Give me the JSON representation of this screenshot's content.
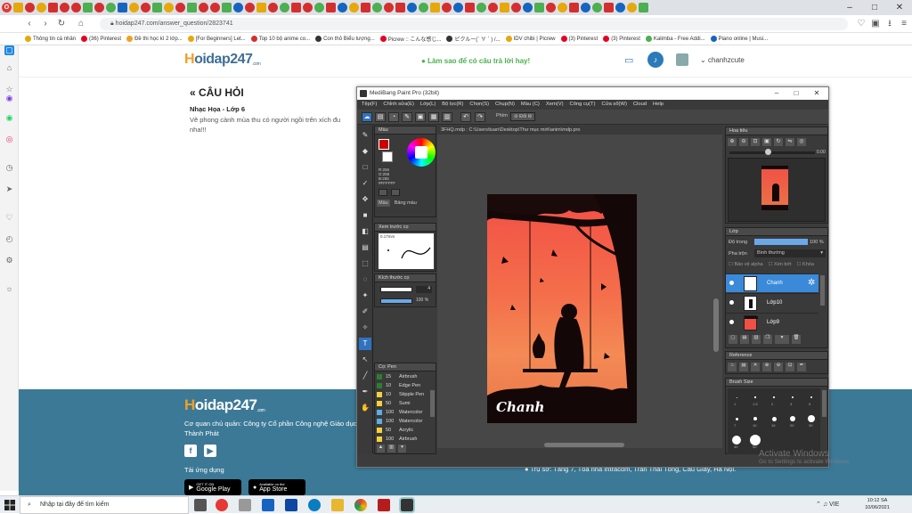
{
  "browser": {
    "url": "hoidap247.com/answer_question/2823741",
    "bookmarks": [
      "Thông tin cá nhân",
      "(36) Pinterest",
      "Đề thi học kì 2 lớp...",
      "[For Beginners] Let...",
      "Top 10 bộ anime co...",
      "Con thỏ Biểu tượng...",
      "Picrew :: こんな感じ...",
      "ピクルー(´ ∀ ` ) /...",
      "IDV chibi | Picrew",
      "(3) Pinterest",
      "(3) Pinterest",
      "Kalimba - Free Addi...",
      "Piano online | Musi..."
    ]
  },
  "site": {
    "logo_main": "oidap247",
    "logo_h": "H",
    "logo_sub": ".com",
    "help": "Làm sao để có câu trả lời hay!",
    "username": "chanhzcute"
  },
  "question": {
    "heading": "« CÂU HỎI",
    "meta": "Nhạc Họa - Lớp 6",
    "text": "Vẽ phong cảnh mùa thu có người ngồi trên xích đu nha!!!"
  },
  "footer": {
    "company": "Cơ quan chủ quản: Công ty Cổ phần Công nghệ Giáo dục Thành Phát",
    "apps_label": "Tải ứng dụng",
    "google_small": "GET IT ON",
    "google": "Google Play",
    "apple_small": "Available on the",
    "apple": "App Store",
    "address": "Trụ sở: Tầng 7, Tòa nhà Intracom, Trần Thái Tông, Cầu Giấy, Hà Nội."
  },
  "medibang": {
    "title": "MediBang Paint Pro (32bit)",
    "menu": [
      "Tệp(F)",
      "Chỉnh sửa(E)",
      "Lớp(L)",
      "Bộ lọc(R)",
      "Chọn(S)",
      "Chụp(N)",
      "Màu (C)",
      "Xem(V)",
      "Công cụ(T)",
      "Cửa sổ(W)",
      "Cloud",
      "Help"
    ],
    "toolbar_label1": "Phím",
    "toolbar_label2": "Đối lệ",
    "file_tab": "3FHQ.mdp : C:\\Users\\tuan\\Desktop\\Thư mục mới\\anim\\mdp.pro",
    "color_panel": "Màu",
    "color_values": [
      "R:255",
      "G:255",
      "B:255",
      "#FFFFFF"
    ],
    "color_tabs": [
      "Màu",
      "Bảng màu"
    ],
    "brush_preview": "Xem trước cọ",
    "brush_preview_value": "0.17mm",
    "brush_size_panel": "Kích thước cọ",
    "brush_size": "4",
    "opacity": "100 %",
    "brush_list_panel": "Cọ: Pen",
    "brushes": [
      {
        "size": "15",
        "name": "Airbrush",
        "color": "#2e7d32"
      },
      {
        "size": "10",
        "name": "Edge Pen",
        "color": "#2e7d32"
      },
      {
        "size": "10",
        "name": "Stipple Pen",
        "color": "#f4d03f"
      },
      {
        "size": "50",
        "name": "Sumi",
        "color": "#f4d03f"
      },
      {
        "size": "100",
        "name": "Watercolor",
        "color": "#5dade2"
      },
      {
        "size": "100",
        "name": "Watercolor",
        "color": "#5dade2"
      },
      {
        "size": "50",
        "name": "Acrylic",
        "color": "#f4d03f"
      },
      {
        "size": "100",
        "name": "Airbrush",
        "color": "#f4d03f"
      }
    ],
    "navigator": "Hoa tiêu",
    "navigator_value": "0.00",
    "layer_panel": "Lớp",
    "opacity_label": "Độ trong",
    "opacity_value": "100 %",
    "blend_label": "Pha trộn",
    "blend_value": "Bình thường",
    "checks": [
      "Bảo vệ alpha",
      "Xén bớt",
      "Khóa"
    ],
    "layers": [
      "Chanh",
      "Lớp10",
      "Lớp9"
    ],
    "reference_panel": "Reference",
    "brush_size_grid": "Brush Size",
    "brush_size_values": [
      "1",
      "1.5",
      "2",
      "3",
      "5",
      "7",
      "10",
      "15",
      "20",
      "30",
      "40",
      "50"
    ]
  },
  "artwork": {
    "signature": "Chanh",
    "gradient_top": "#f24f45",
    "gradient_bottom": "#e97448"
  },
  "windows": {
    "activate": "Activate Windows",
    "activate_sub": "Go to Settings to activate Windows.",
    "search": "Nhập tại đây để tìm kiếm",
    "time": "10:12 SA",
    "date": "10/06/2021",
    "lang": "VIE"
  }
}
